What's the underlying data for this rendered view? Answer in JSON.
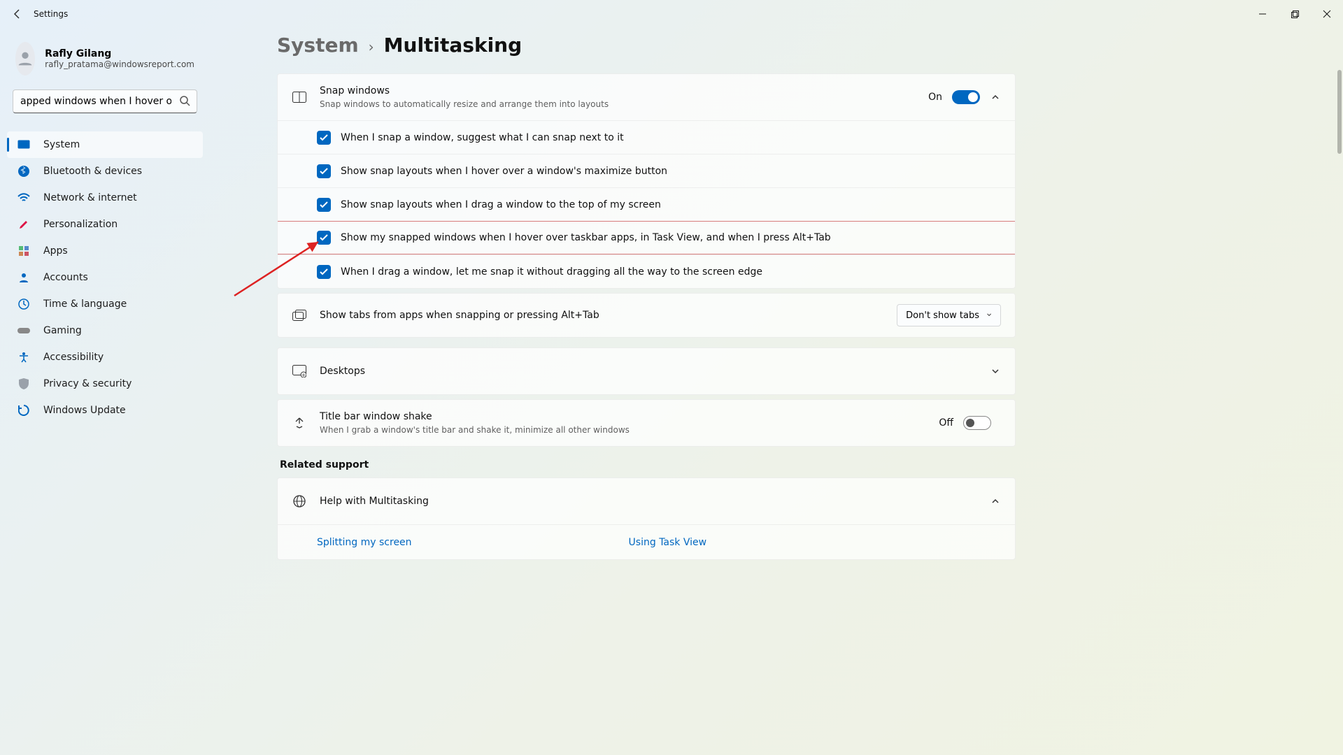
{
  "window": {
    "title": "Settings"
  },
  "user": {
    "name": "Rafly Gilang",
    "email": "rafly_pratama@windowsreport.com"
  },
  "search": {
    "value": "apped windows when I hover over"
  },
  "nav": {
    "items": [
      {
        "label": "System"
      },
      {
        "label": "Bluetooth & devices"
      },
      {
        "label": "Network & internet"
      },
      {
        "label": "Personalization"
      },
      {
        "label": "Apps"
      },
      {
        "label": "Accounts"
      },
      {
        "label": "Time & language"
      },
      {
        "label": "Gaming"
      },
      {
        "label": "Accessibility"
      },
      {
        "label": "Privacy & security"
      },
      {
        "label": "Windows Update"
      }
    ]
  },
  "breadcrumb": {
    "parent": "System",
    "current": "Multitasking"
  },
  "snap": {
    "title": "Snap windows",
    "subtitle": "Snap windows to automatically resize and arrange them into layouts",
    "state": "On",
    "options": [
      "When I snap a window, suggest what I can snap next to it",
      "Show snap layouts when I hover over a window's maximize button",
      "Show snap layouts when I drag a window to the top of my screen",
      "Show my snapped windows when I hover over taskbar apps, in Task View, and when I press Alt+Tab",
      "When I drag a window, let me snap it without dragging all the way to the screen edge"
    ],
    "tabs": {
      "label": "Show tabs from apps when snapping or pressing Alt+Tab",
      "value": "Don't show tabs"
    }
  },
  "desktops": {
    "title": "Desktops"
  },
  "shake": {
    "title": "Title bar window shake",
    "subtitle": "When I grab a window's title bar and shake it, minimize all other windows",
    "state": "Off"
  },
  "related": {
    "heading": "Related support",
    "help": "Help with Multitasking",
    "links": [
      "Splitting my screen",
      "Using Task View"
    ]
  }
}
